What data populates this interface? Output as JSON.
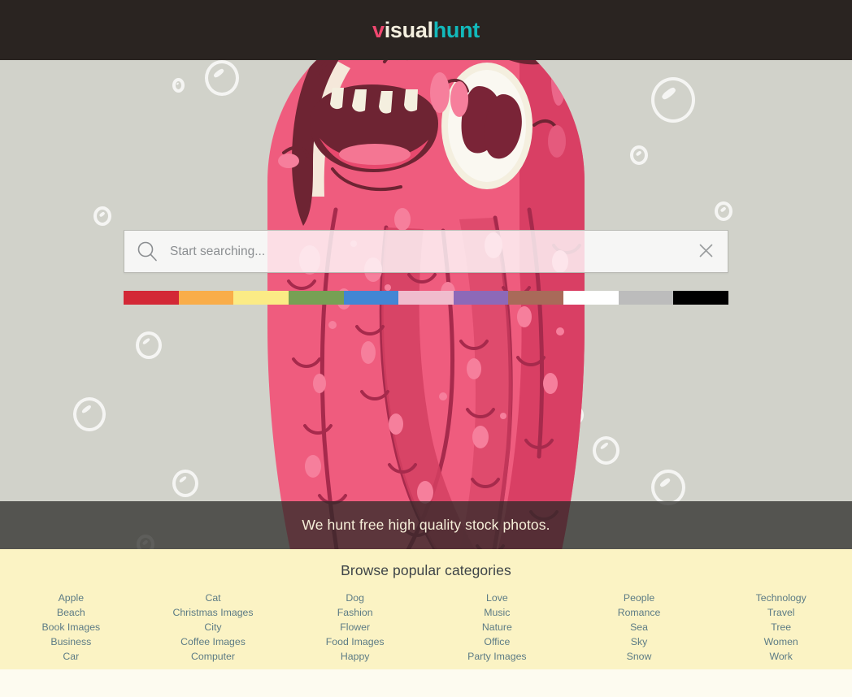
{
  "header": {
    "logo": {
      "part1": "v",
      "part2": "isual",
      "part3": "hunt"
    },
    "logo_colors": {
      "v": "#ef476f",
      "isual": "#f4efdf",
      "hunt": "#12b9bb"
    },
    "background": "#2a2421"
  },
  "hero": {
    "background": "#d1d2ca",
    "illustration": "pink-monster-illustration",
    "search": {
      "icon": "search-icon",
      "placeholder": "Start searching...",
      "value": "",
      "clear_icon": "close-icon"
    },
    "color_filter": {
      "label": "color-swatches",
      "swatches": [
        {
          "name": "red",
          "hex": "#d32836"
        },
        {
          "name": "orange",
          "hex": "#f9ad49"
        },
        {
          "name": "yellow",
          "hex": "#fbeb85"
        },
        {
          "name": "green",
          "hex": "#77a054"
        },
        {
          "name": "blue",
          "hex": "#4286d4"
        },
        {
          "name": "pink",
          "hex": "#f0bccd"
        },
        {
          "name": "purple",
          "hex": "#8d69b8"
        },
        {
          "name": "brown",
          "hex": "#a96a59"
        },
        {
          "name": "white",
          "hex": "#ffffff"
        },
        {
          "name": "gray",
          "hex": "#bcbcbc"
        },
        {
          "name": "black",
          "hex": "#000000"
        }
      ]
    },
    "tagline": "We hunt free high quality stock photos.",
    "tagline_color": "#f6efd9"
  },
  "categories": {
    "title": "Browse popular categories",
    "background": "#fbf3c4",
    "link_color": "#5c7b85",
    "columns": [
      {
        "items": [
          "Apple",
          "Beach",
          "Book Images",
          "Business",
          "Car"
        ]
      },
      {
        "items": [
          "Cat",
          "Christmas Images",
          "City",
          "Coffee Images",
          "Computer"
        ]
      },
      {
        "items": [
          "Dog",
          "Fashion",
          "Flower",
          "Food Images",
          "Happy"
        ]
      },
      {
        "items": [
          "Love",
          "Music",
          "Nature",
          "Office",
          "Party Images"
        ]
      },
      {
        "items": [
          "People",
          "Romance",
          "Sea",
          "Sky",
          "Snow"
        ]
      },
      {
        "items": [
          "Technology",
          "Travel",
          "Tree",
          "Women",
          "Work"
        ]
      }
    ]
  }
}
